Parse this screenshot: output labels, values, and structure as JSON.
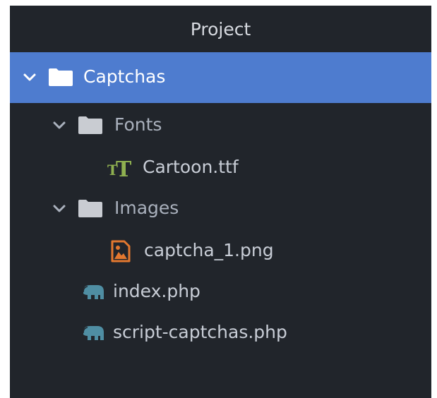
{
  "panel": {
    "title": "Project"
  },
  "tree": {
    "root": {
      "label": "Captchas",
      "icon": "folder-open-icon",
      "expanded": true,
      "selected": true
    },
    "fonts_folder": {
      "label": "Fonts",
      "icon": "folder-icon",
      "expanded": true
    },
    "font_file": {
      "label": "Cartoon.ttf",
      "icon": "font-file-icon"
    },
    "images_folder": {
      "label": "Images",
      "icon": "folder-icon",
      "expanded": true
    },
    "image_file": {
      "label": "captcha_1.png",
      "icon": "image-file-icon"
    },
    "php_file_1": {
      "label": "index.php",
      "icon": "php-elephant-icon"
    },
    "php_file_2": {
      "label": "script-captchas.php",
      "icon": "php-elephant-icon"
    }
  },
  "colors": {
    "panel_bg": "#21252b",
    "selection": "#4e7ccf",
    "font_icon": "#8fb050",
    "image_icon": "#e3782f",
    "php_icon": "#4f8ea3",
    "folder": "#d3d6dc"
  }
}
